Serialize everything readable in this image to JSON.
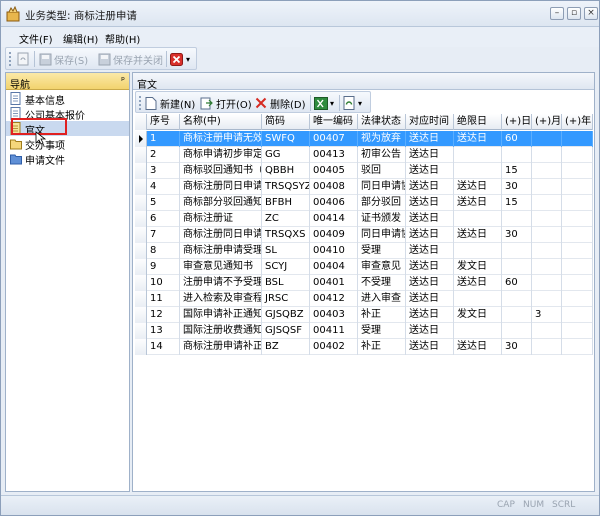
{
  "window": {
    "title": "业务类型: 商标注册申请"
  },
  "menu": {
    "file": "文件(F)",
    "edit": "编辑(H)",
    "help": "帮助(H)"
  },
  "toolbar": {
    "save": "保存(S)",
    "save_close": "保存并关闭"
  },
  "nav": {
    "header": "导航",
    "items": [
      {
        "label": "基本信息"
      },
      {
        "label": "公司基本报价"
      },
      {
        "label": "官文"
      },
      {
        "label": "交办事项"
      },
      {
        "label": "申请文件"
      }
    ]
  },
  "content": {
    "header": "官文",
    "toolbar": {
      "new": "新建(N)",
      "open": "打开(O)",
      "delete": "删除(D)"
    },
    "grid": {
      "columns": [
        "序号",
        "名称(中)",
        "简码",
        "唯一编码",
        "法律状态",
        "对应时间",
        "绝限日",
        "(+)日",
        "(+)月",
        "(+)年"
      ],
      "rows": [
        [
          "1",
          "商标注册申请无效",
          "SWFQ",
          "00407",
          "视为放弃",
          "送达日",
          "送达日",
          "60",
          "",
          ""
        ],
        [
          "2",
          "商标申请初步审定",
          "GG",
          "00413",
          "初审公告",
          "送达日",
          "",
          "",
          "",
          ""
        ],
        [
          "3",
          "商标驳回通知书（",
          "QBBH",
          "00405",
          "驳回",
          "送达日",
          "",
          "15",
          "",
          ""
        ],
        [
          "4",
          "商标注册同日申请",
          "TRSQSYZ",
          "00408",
          "同日申请协",
          "送达日",
          "送达日",
          "30",
          "",
          ""
        ],
        [
          "5",
          "商标部分驳回通知",
          "BFBH",
          "00406",
          "部分驳回",
          "送达日",
          "送达日",
          "15",
          "",
          ""
        ],
        [
          "6",
          "商标注册证",
          "ZC",
          "00414",
          "证书颁发",
          "送达日",
          "",
          "",
          "",
          ""
        ],
        [
          "7",
          "商标注册同日申请",
          "TRSQXS",
          "00409",
          "同日申请协",
          "送达日",
          "送达日",
          "30",
          "",
          ""
        ],
        [
          "8",
          "商标注册申请受理",
          "SL",
          "00410",
          "受理",
          "送达日",
          "",
          "",
          "",
          ""
        ],
        [
          "9",
          "审查意见通知书",
          "SCYJ",
          "00404",
          "审查意见",
          "送达日",
          "发文日",
          "",
          "",
          ""
        ],
        [
          "10",
          "注册申请不予受理",
          "BSL",
          "00401",
          "不受理",
          "送达日",
          "送达日",
          "60",
          "",
          ""
        ],
        [
          "11",
          "进入检索及审查程",
          "JRSC",
          "00412",
          "进入审查",
          "送达日",
          "",
          "",
          "",
          ""
        ],
        [
          "12",
          "国际申请补正通知",
          "GJSQBZ",
          "00403",
          "补正",
          "送达日",
          "发文日",
          "",
          "3",
          ""
        ],
        [
          "13",
          "国际注册收费通知",
          "GJSQSF",
          "00411",
          "受理",
          "送达日",
          "",
          "",
          "",
          ""
        ],
        [
          "14",
          "商标注册申请补正",
          "BZ",
          "00402",
          "补正",
          "送达日",
          "送达日",
          "30",
          "",
          ""
        ]
      ]
    }
  },
  "status": {
    "cap": "CAP",
    "num": "NUM",
    "scrl": "SCRL"
  }
}
